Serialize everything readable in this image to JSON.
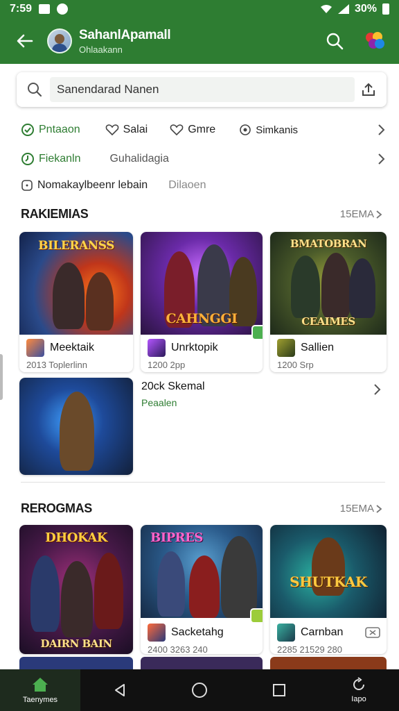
{
  "status_bar": {
    "time": "7:59",
    "battery": "30%"
  },
  "app_bar": {
    "title": "SahanlApamall",
    "subtitle": "Ohlaakann"
  },
  "search": {
    "value": "Sanendarad Nanen"
  },
  "filters": {
    "row1": [
      "Pntaaon",
      "Salai",
      "Gmre",
      "Simkanis"
    ],
    "row2": [
      "Fiekanln",
      "Guhalidagia"
    ],
    "row3": [
      "Nomakaylbeenr lebain",
      "Dilaoen"
    ]
  },
  "section1": {
    "title": "RAKIEMIAS",
    "more": "15EMA",
    "cards": [
      {
        "art_title": "BILERANSS",
        "name": "Meektaik",
        "sub": "2013 Toplerlinn"
      },
      {
        "art_title": "CAHNGGI",
        "name": "Unrktopik",
        "sub": "1200 2pp"
      },
      {
        "art_title": "BMATOBRAN",
        "art_badge": "CEAIMES",
        "name": "Sallien",
        "sub": "1200 Srp"
      }
    ],
    "feature": {
      "name": "20ck Skemal",
      "sub": "Peaalen"
    }
  },
  "section2": {
    "title": "REROGMAS",
    "more": "15EMA",
    "cards": [
      {
        "art_title": "DHOKAK",
        "art_bottom": "DAIRN BAIN"
      },
      {
        "art_title": "BIPRES",
        "name": "Sacketahg",
        "sub": "2400 3263 240"
      },
      {
        "art_title": "SHUTKAK",
        "name": "Carnban",
        "sub": "2285 21529 280"
      }
    ]
  },
  "bottom_nav": {
    "home_label": "Taenymes",
    "last_label": "Iapo"
  },
  "colors": {
    "primary": "#2e7d32",
    "accent": "#43a047"
  }
}
